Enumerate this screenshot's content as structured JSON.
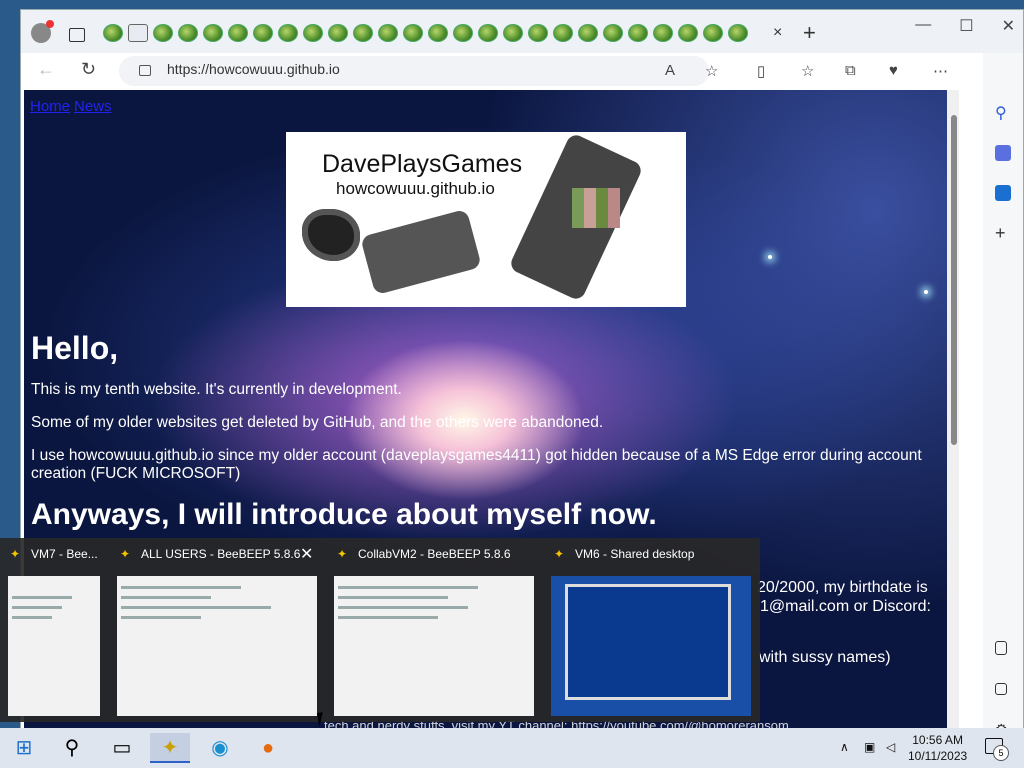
{
  "browser": {
    "url": "https://howcowuuu.github.io",
    "tab_close": "×",
    "new_tab": "+",
    "win_min": "—",
    "win_max": "☐",
    "win_close": "✕"
  },
  "page": {
    "nav": [
      "Home",
      "News"
    ],
    "banner_title": "DavePlaysGames",
    "banner_subtitle": "howcowuuu.github.io",
    "heading": "Hello,",
    "paragraphs": [
      "This is my tenth website. It's currently in development.",
      "Some of my older websites get deleted by GitHub, and the others were abandoned.",
      "I use howcowuuu.github.io since my older account (daveplaysgames4411) got hidden because of a MS Edge error during account creation (FUCK MICROSOFT)"
    ],
    "subheading": "Anyways, I will introduce about myself now.",
    "partial_texts": [
      "20/2000, my birthdate is",
      "1@mail.com or Discord:",
      "with sussy names)",
      "tech and nerdy stuffs, visit my YT channel: https://youtube.com/@homoreransom"
    ]
  },
  "taskbar_popup": {
    "items": [
      {
        "title": "VM7 - Bee..."
      },
      {
        "title": "ALL USERS - BeeBEEP 5.8.6"
      },
      {
        "title": "CollabVM2 - BeeBEEP 5.8.6"
      },
      {
        "title": "VM6 - Shared desktop"
      }
    ],
    "close": "✕"
  },
  "taskbar": {
    "time": "10:56 AM",
    "date": "10/11/2023",
    "notifications": "5"
  },
  "colors": {
    "accent": "#2a62c9",
    "link": "#2222ee"
  }
}
